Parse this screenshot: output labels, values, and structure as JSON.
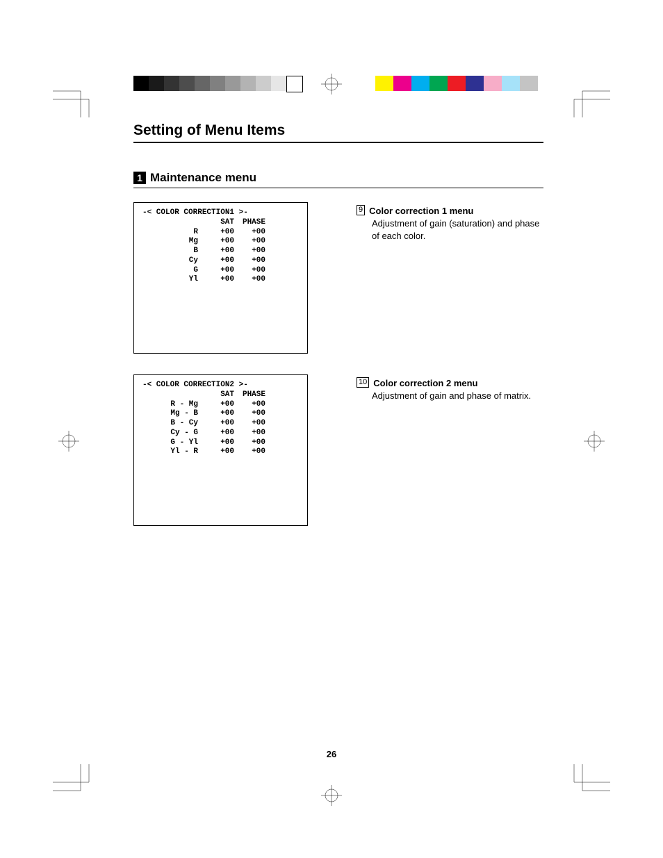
{
  "title": "Setting of Menu Items",
  "subtitle_num": "1",
  "subtitle": "Maintenance menu",
  "box1": {
    "header": "-< COLOR CORRECTION1 >-",
    "col_sat": "SAT",
    "col_phase": "PHASE",
    "rows": [
      {
        "label": "R",
        "sat": "+00",
        "phase": "+00"
      },
      {
        "label": "Mg",
        "sat": "+00",
        "phase": "+00"
      },
      {
        "label": "B",
        "sat": "+00",
        "phase": "+00"
      },
      {
        "label": "Cy",
        "sat": "+00",
        "phase": "+00"
      },
      {
        "label": "G",
        "sat": "+00",
        "phase": "+00"
      },
      {
        "label": "Yl",
        "sat": "+00",
        "phase": "+00"
      }
    ]
  },
  "desc1": {
    "idx": "9",
    "title": "Color correction 1 menu",
    "body": "Adjustment of gain (saturation) and phase of each color."
  },
  "box2": {
    "header": "-< COLOR CORRECTION2 >-",
    "col_sat": "SAT",
    "col_phase": "PHASE",
    "rows": [
      {
        "label": "R - Mg",
        "sat": "+00",
        "phase": "+00"
      },
      {
        "label": "Mg - B",
        "sat": "+00",
        "phase": "+00"
      },
      {
        "label": "B - Cy",
        "sat": "+00",
        "phase": "+00"
      },
      {
        "label": "Cy - G",
        "sat": "+00",
        "phase": "+00"
      },
      {
        "label": "G - Yl",
        "sat": "+00",
        "phase": "+00"
      },
      {
        "label": "Yl - R",
        "sat": "+00",
        "phase": "+00"
      }
    ]
  },
  "desc2": {
    "idx": "10",
    "title": "Color correction 2 menu",
    "body": "Adjustment of gain and phase of matrix."
  },
  "page_num": "26",
  "colorbar_left": [
    "#000000",
    "#1a1a1a",
    "#333333",
    "#4d4d4d",
    "#666666",
    "#808080",
    "#999999",
    "#b3b3b3",
    "#cccccc",
    "#e6e6e6",
    "#ffffff"
  ],
  "colorbar_right": [
    "#fff200",
    "#ec008c",
    "#00aeef",
    "#00a651",
    "#ed1c24",
    "#2e3192",
    "#f7adc8",
    "#a6e2f9",
    "#c4c4c4"
  ]
}
